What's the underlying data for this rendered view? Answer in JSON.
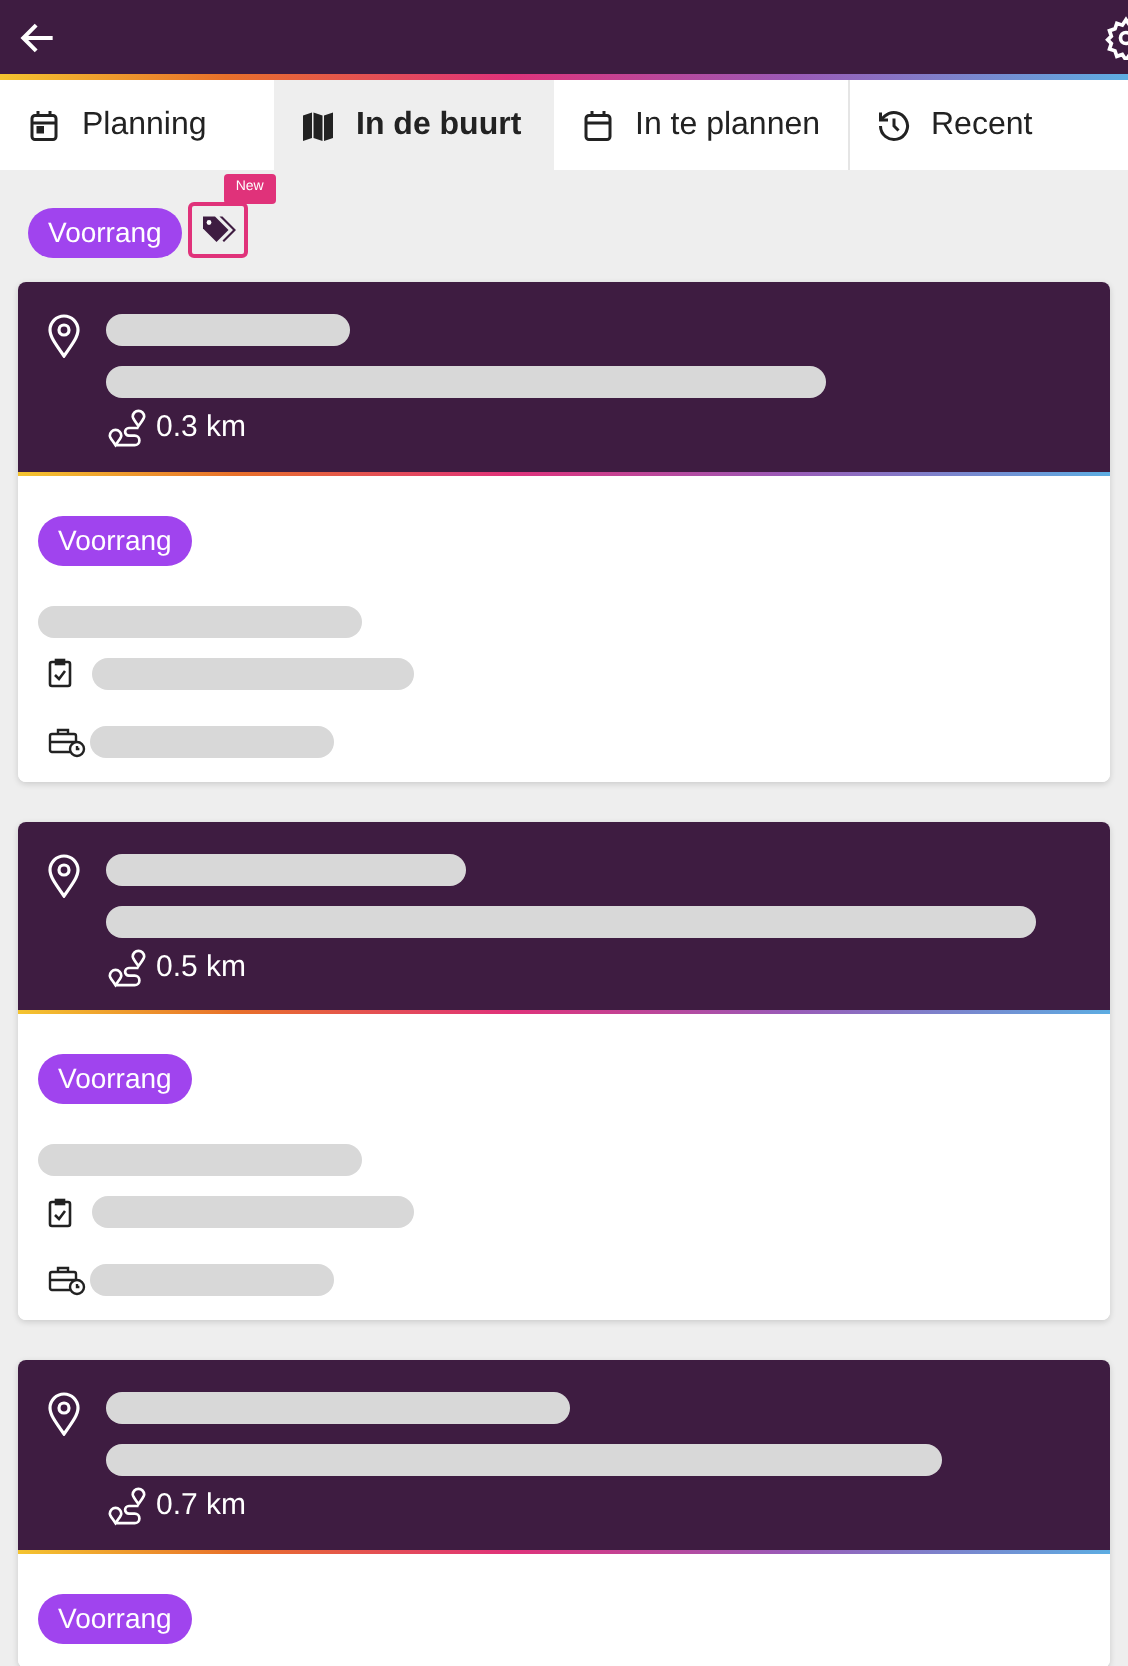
{
  "tabs": [
    {
      "label": "Planning",
      "kind": "calendar",
      "selected": false
    },
    {
      "label": "In de buurt",
      "kind": "map",
      "selected": true
    },
    {
      "label": "In te plannen",
      "kind": "calendar-blank",
      "selected": false
    },
    {
      "label": "Recent",
      "kind": "history",
      "selected": false
    }
  ],
  "filters": {
    "chip": "Voorrang",
    "tag_badge": "New"
  },
  "cards": [
    {
      "distance": "0.3 km",
      "badge": "Voorrang",
      "details": true
    },
    {
      "distance": "0.5 km",
      "badge": "Voorrang",
      "details": true
    },
    {
      "distance": "0.7 km",
      "badge": "Voorrang",
      "details": false
    }
  ]
}
